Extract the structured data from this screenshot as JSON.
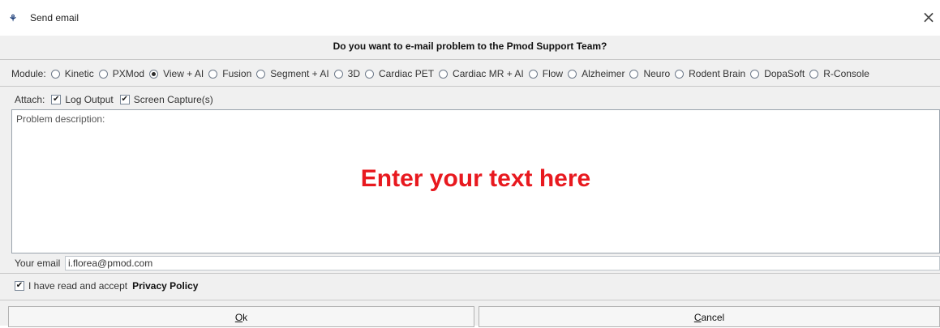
{
  "window": {
    "icon": "PMOD-logo-icon",
    "icon_text": "⚘",
    "title": "Send email",
    "close_glyph": "×"
  },
  "question": "Do you want to e-mail problem to the Pmod Support Team?",
  "module": {
    "label": "Module:",
    "options": [
      {
        "label": "Kinetic",
        "checked": false
      },
      {
        "label": "PXMod",
        "checked": false
      },
      {
        "label": "View + AI",
        "checked": true
      },
      {
        "label": "Fusion",
        "checked": false
      },
      {
        "label": "Segment + AI",
        "checked": false
      },
      {
        "label": "3D",
        "checked": false
      },
      {
        "label": "Cardiac PET",
        "checked": false
      },
      {
        "label": "Cardiac MR + AI",
        "checked": false
      },
      {
        "label": "Flow",
        "checked": false
      },
      {
        "label": "Alzheimer",
        "checked": false
      },
      {
        "label": "Neuro",
        "checked": false
      },
      {
        "label": "Rodent Brain",
        "checked": false
      },
      {
        "label": "DopaSoft",
        "checked": false
      },
      {
        "label": "R-Console",
        "checked": false
      }
    ]
  },
  "attach": {
    "label": "Attach:",
    "log_output": {
      "label": "Log Output",
      "checked": true
    },
    "screen_capture": {
      "label": "Screen Capture(s)",
      "checked": true
    }
  },
  "problem": {
    "label": "Problem description:",
    "overlay_text": "Enter your text here"
  },
  "email": {
    "label": "Your email",
    "value": "i.florea@pmod.com"
  },
  "policy": {
    "checked": true,
    "text": "I have read and accept",
    "link": "Privacy Policy"
  },
  "buttons": {
    "ok_mnemonic": "O",
    "ok_rest": "k",
    "cancel_mnemonic": "C",
    "cancel_rest": "ancel"
  },
  "colors": {
    "overlay_text": "#e8191f",
    "dialog_bg": "#f0f0f0"
  }
}
